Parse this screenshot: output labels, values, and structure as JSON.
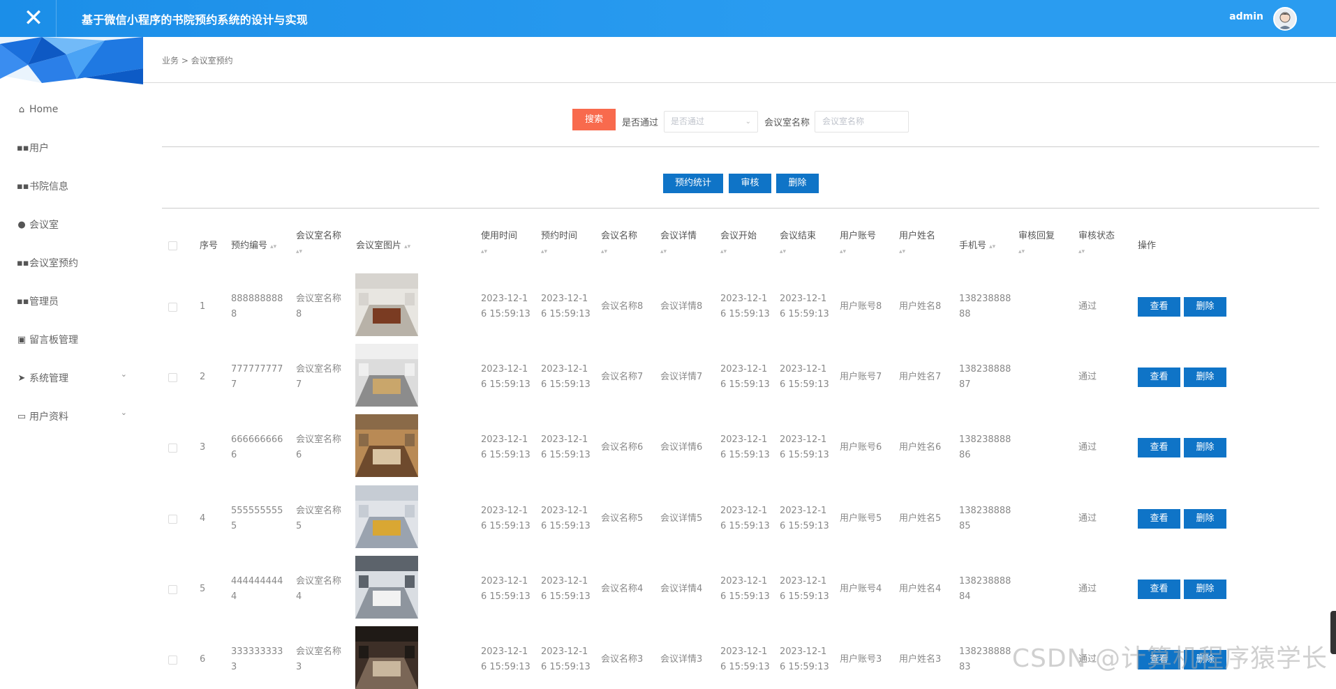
{
  "app": {
    "title": "基于微信小程序的书院预约系统的设计与实现",
    "user": "admin"
  },
  "colors": {
    "topbar": "#2a9cf0",
    "primary": "#0f74c7",
    "search": "#f86a4d"
  },
  "sidebar": {
    "items": [
      {
        "label": "Home",
        "icon": "home-icon"
      },
      {
        "label": "用户",
        "icon": "grid-icon"
      },
      {
        "label": "书院信息",
        "icon": "grid-icon"
      },
      {
        "label": "会议室",
        "icon": "pin-icon"
      },
      {
        "label": "会议室预约",
        "icon": "grid-icon"
      },
      {
        "label": "管理员",
        "icon": "grid-icon"
      },
      {
        "label": "留言板管理",
        "icon": "clipboard-icon"
      },
      {
        "label": "系统管理",
        "icon": "send-icon"
      },
      {
        "label": "用户资料",
        "icon": "card-icon"
      }
    ]
  },
  "breadcrumb": "业务 > 会议室预约",
  "search": {
    "button": "搜索",
    "approved_label": "是否通过",
    "approved_placeholder": "是否通过",
    "room_label": "会议室名称",
    "room_placeholder": "会议室名称"
  },
  "actions": {
    "stats": "预约统计",
    "review": "审核",
    "delete": "删除"
  },
  "table": {
    "headers": {
      "index": "序号",
      "booking_no": "预约编号",
      "room_name": "会议室名称",
      "room_image": "会议室图片",
      "use_time": "使用时间",
      "book_time": "预约时间",
      "meeting_name": "会议名称",
      "meeting_detail": "会议详情",
      "start": "会议开始",
      "end": "会议结束",
      "account": "用户账号",
      "user_name": "用户姓名",
      "phone": "手机号",
      "reply": "审核回复",
      "status": "审核状态",
      "ops": "操作"
    },
    "view_label": "查看",
    "delete_label": "删除",
    "rows": [
      {
        "index": "1",
        "no_a": "888888888",
        "no_b": "8",
        "room_a": "会议室名称",
        "room_b": "8",
        "t_a": "2023-12-1",
        "t_b": "6 15:59:13",
        "meeting": "会议名称8",
        "detail": "会议详情8",
        "account": "用户账号8",
        "uname": "用户姓名8",
        "ph_a": "138238888",
        "ph_b": "88",
        "status": "通过"
      },
      {
        "index": "2",
        "no_a": "777777777",
        "no_b": "7",
        "room_a": "会议室名称",
        "room_b": "7",
        "t_a": "2023-12-1",
        "t_b": "6 15:59:13",
        "meeting": "会议名称7",
        "detail": "会议详情7",
        "account": "用户账号7",
        "uname": "用户姓名7",
        "ph_a": "138238888",
        "ph_b": "87",
        "status": "通过"
      },
      {
        "index": "3",
        "no_a": "666666666",
        "no_b": "6",
        "room_a": "会议室名称",
        "room_b": "6",
        "t_a": "2023-12-1",
        "t_b": "6 15:59:13",
        "meeting": "会议名称6",
        "detail": "会议详情6",
        "account": "用户账号6",
        "uname": "用户姓名6",
        "ph_a": "138238888",
        "ph_b": "86",
        "status": "通过"
      },
      {
        "index": "4",
        "no_a": "555555555",
        "no_b": "5",
        "room_a": "会议室名称",
        "room_b": "5",
        "t_a": "2023-12-1",
        "t_b": "6 15:59:13",
        "meeting": "会议名称5",
        "detail": "会议详情5",
        "account": "用户账号5",
        "uname": "用户姓名5",
        "ph_a": "138238888",
        "ph_b": "85",
        "status": "通过"
      },
      {
        "index": "5",
        "no_a": "444444444",
        "no_b": "4",
        "room_a": "会议室名称",
        "room_b": "4",
        "t_a": "2023-12-1",
        "t_b": "6 15:59:13",
        "meeting": "会议名称4",
        "detail": "会议详情4",
        "account": "用户账号4",
        "uname": "用户姓名4",
        "ph_a": "138238888",
        "ph_b": "84",
        "status": "通过"
      },
      {
        "index": "6",
        "no_a": "333333333",
        "no_b": "3",
        "room_a": "会议室名称",
        "room_b": "3",
        "t_a": "2023-12-1",
        "t_b": "6 15:59:13",
        "meeting": "会议名称3",
        "detail": "会议详情3",
        "account": "用户账号3",
        "uname": "用户姓名3",
        "ph_a": "138238888",
        "ph_b": "83",
        "status": "通过"
      }
    ]
  },
  "watermark": "CSDN @计算机程序猿学长"
}
